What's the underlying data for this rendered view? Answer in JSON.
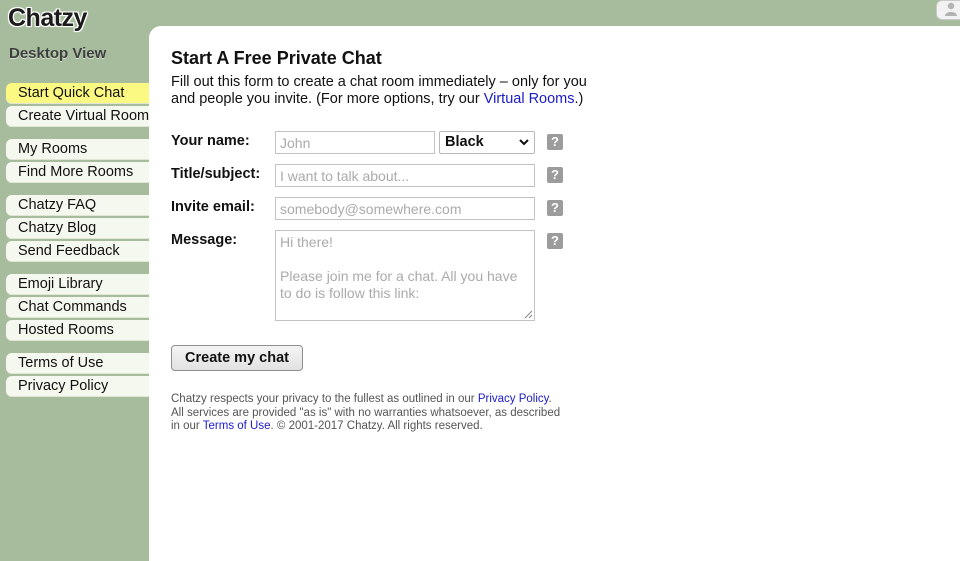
{
  "brand": {
    "logo": "Chatzy",
    "view_mode": "Desktop View"
  },
  "sidebar": {
    "groups": [
      {
        "items": [
          {
            "label": "Start Quick Chat",
            "active": true
          },
          {
            "label": "Create Virtual Room"
          }
        ]
      },
      {
        "items": [
          {
            "label": "My Rooms"
          },
          {
            "label": "Find More Rooms"
          }
        ]
      },
      {
        "items": [
          {
            "label": "Chatzy FAQ"
          },
          {
            "label": "Chatzy Blog"
          },
          {
            "label": "Send Feedback"
          }
        ]
      },
      {
        "items": [
          {
            "label": "Emoji Library"
          },
          {
            "label": "Chat Commands"
          },
          {
            "label": "Hosted Rooms"
          }
        ]
      },
      {
        "items": [
          {
            "label": "Terms of Use"
          },
          {
            "label": "Privacy Policy"
          }
        ]
      }
    ]
  },
  "main": {
    "title": "Start A Free Private Chat",
    "intro_before_link": "Fill out this form to create a chat room immediately – only for you and people you invite. (For more options, try our ",
    "intro_link": "Virtual Rooms",
    "intro_after_link": ".)",
    "form": {
      "name_label": "Your name:",
      "name_placeholder": "John",
      "color_value": "Black",
      "subject_label": "Title/subject:",
      "subject_placeholder": "I want to talk about...",
      "email_label": "Invite email:",
      "email_placeholder": "somebody@somewhere.com",
      "message_label": "Message:",
      "message_placeholder": "Hi there!\n\nPlease join me for a chat. All you have to do is follow this link:",
      "help_glyph": "?",
      "submit_label": "Create my chat"
    },
    "footer": {
      "part1": "Chatzy respects your privacy to the fullest as outlined in our ",
      "privacy_link": "Privacy Policy",
      "part2": ". All services are provided \"as is\" with no warranties whatsoever, as described in our ",
      "terms_link": "Terms of Use",
      "part3": ". © 2001-2017 Chatzy. All rights reserved."
    }
  },
  "colors": {
    "background": "#a7bc9d",
    "panel": "#ffffff",
    "nav_item": "#f5f8ef",
    "nav_active": "#fbf981",
    "link": "#1a1ac9",
    "help_button": "#9c9c9c"
  },
  "icons": {
    "user": "user-icon",
    "help": "help-icon",
    "collapse": "collapse-arrow-icon",
    "dropdown": "chevron-down-icon"
  }
}
